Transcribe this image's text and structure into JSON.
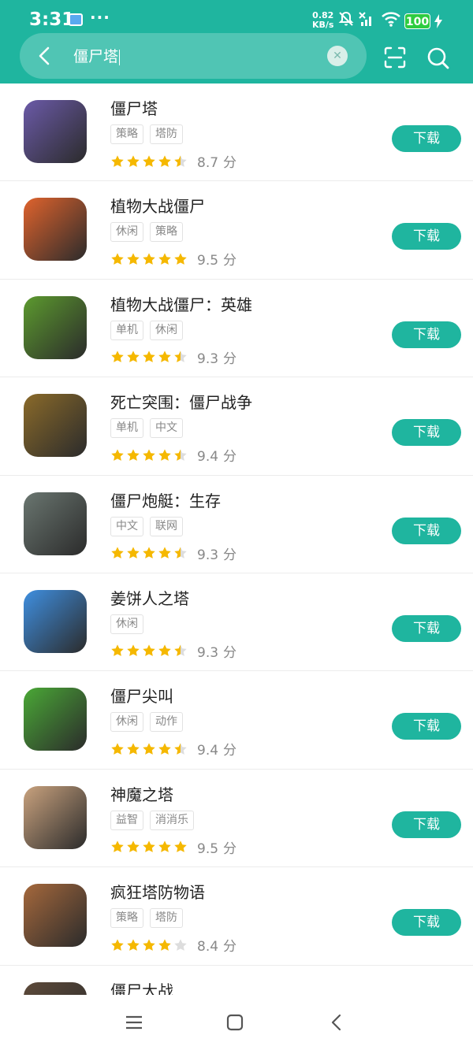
{
  "status": {
    "time": "3:31",
    "dots": "···",
    "net_speed": "0.82",
    "net_unit": "KB/s",
    "battery": "100"
  },
  "search": {
    "query": "僵尸塔"
  },
  "download_label": "下载",
  "score_unit": "分",
  "apps": [
    {
      "name": "僵尸塔",
      "tags": [
        "策略",
        "塔防"
      ],
      "score": "8.7",
      "stars": 4.5,
      "bg": "#6b5aa8"
    },
    {
      "name": "植物大战僵尸",
      "tags": [
        "休闲",
        "策略"
      ],
      "score": "9.5",
      "stars": 5,
      "bg": "#e0632d"
    },
    {
      "name": "植物大战僵尸：英雄",
      "tags": [
        "单机",
        "休闲"
      ],
      "score": "9.3",
      "stars": 4.5,
      "bg": "#5c9a2e"
    },
    {
      "name": "死亡突围：僵尸战争",
      "tags": [
        "单机",
        "中文"
      ],
      "score": "9.4",
      "stars": 4.5,
      "bg": "#8a6a2a"
    },
    {
      "name": "僵尸炮艇：生存",
      "tags": [
        "中文",
        "联网"
      ],
      "score": "9.3",
      "stars": 4.5,
      "bg": "#6a7670"
    },
    {
      "name": "姜饼人之塔",
      "tags": [
        "休闲"
      ],
      "score": "9.3",
      "stars": 4.5,
      "bg": "#3f8fe0"
    },
    {
      "name": "僵尸尖叫",
      "tags": [
        "休闲",
        "动作"
      ],
      "score": "9.4",
      "stars": 4.5,
      "bg": "#4aa836"
    },
    {
      "name": "神魔之塔",
      "tags": [
        "益智",
        "消消乐"
      ],
      "score": "9.5",
      "stars": 5,
      "bg": "#c9a27e"
    },
    {
      "name": "疯狂塔防物语",
      "tags": [
        "策略",
        "塔防"
      ],
      "score": "8.4",
      "stars": 4,
      "bg": "#a5683c"
    },
    {
      "name": "僵尸大战",
      "tags": [],
      "score": "",
      "stars": 0,
      "bg": "#5d4a3a"
    }
  ],
  "colors": {
    "accent": "#1fb59f",
    "star": "#f5b800",
    "star_empty": "#dddddd"
  }
}
